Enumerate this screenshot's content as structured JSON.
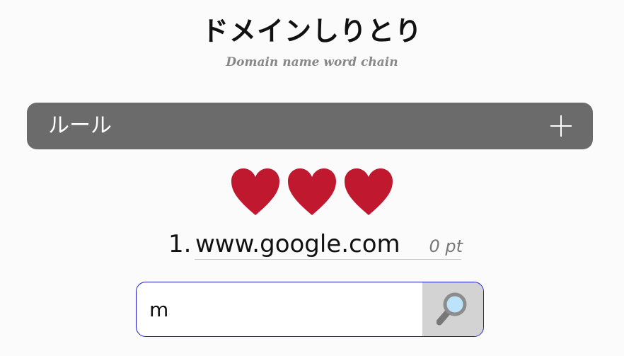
{
  "header": {
    "title": "ドメインしりとり",
    "subtitle": "Domain name word chain"
  },
  "rules": {
    "label": "ルール",
    "toggle_icon": "plus-icon"
  },
  "lives": {
    "count": 3,
    "max": 3,
    "icon": "heart-icon",
    "color": "#c0192f"
  },
  "history": [
    {
      "number": "1.",
      "domain": "www.google.com",
      "points": "0 pt"
    }
  ],
  "search": {
    "value": "m",
    "button_icon": "magnifying-glass-icon",
    "border_color": "#1a1acc"
  },
  "colors": {
    "rules_bar": "#6b6b6b",
    "search_button_bg": "#d3d3d3"
  }
}
